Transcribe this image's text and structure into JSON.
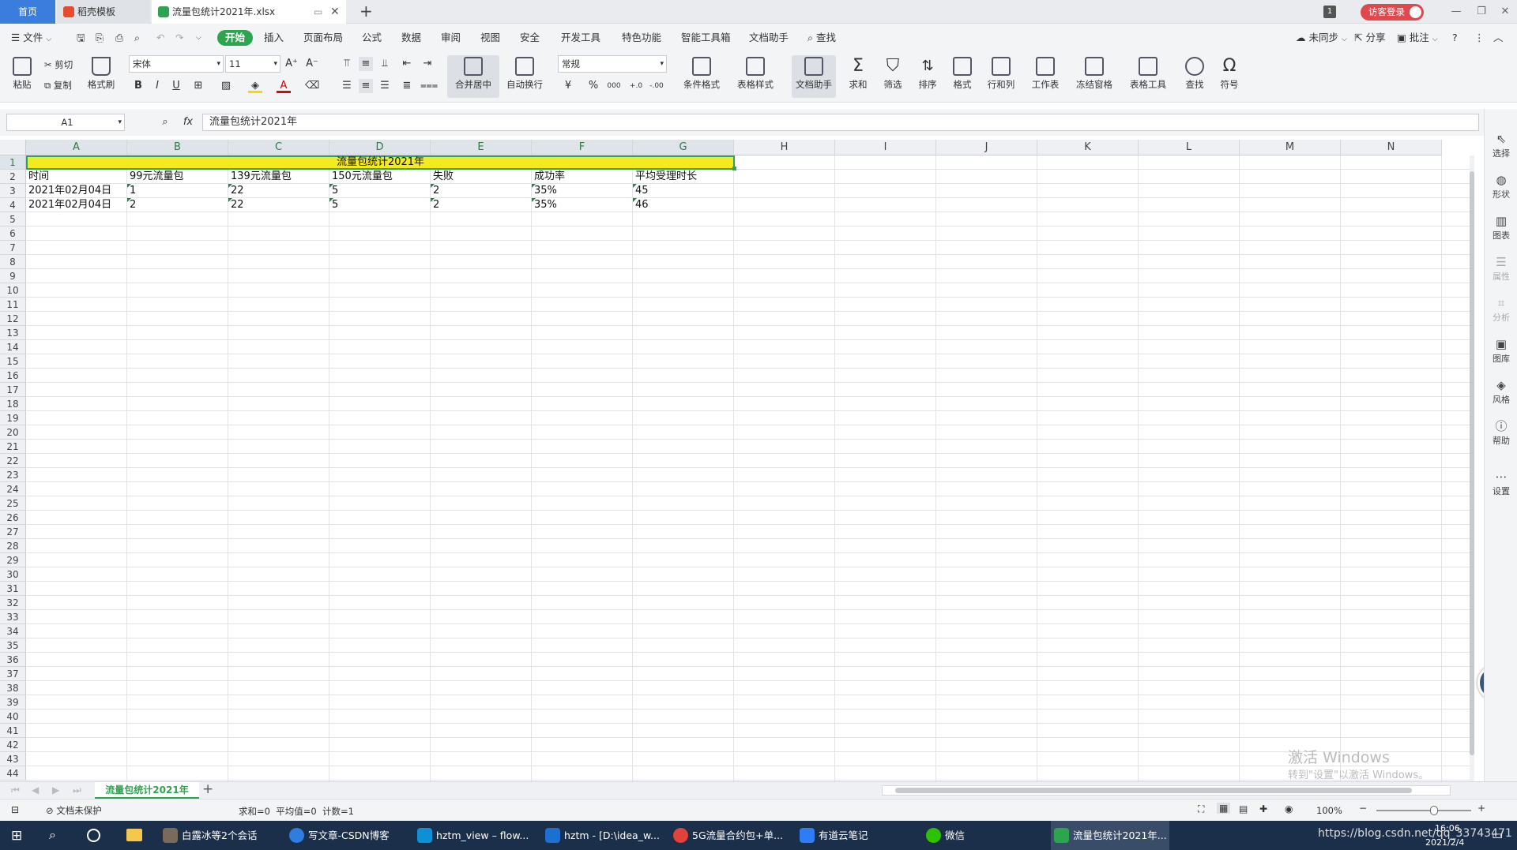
{
  "titlebar": {
    "tab_home": "首页",
    "tab_template": "稻壳模板",
    "tab_file": "流量包统计2021年.xlsx",
    "badge": "1",
    "login": "访客登录"
  },
  "menubar": {
    "file": "文件",
    "start": "开始",
    "items": [
      "插入",
      "页面布局",
      "公式",
      "数据",
      "审阅",
      "视图",
      "安全",
      "开发工具",
      "特色功能",
      "智能工具箱",
      "文档助手"
    ],
    "search": "查找",
    "sync": "未同步",
    "share": "分享",
    "annotate": "批注"
  },
  "ribbon": {
    "paste": "粘贴",
    "cut": "剪切",
    "copy": "复制",
    "format_painter": "格式刷",
    "font_name": "宋体",
    "font_size": "11",
    "merge": "合并居中",
    "wrap": "自动换行",
    "number_format": "常规",
    "cond_format": "条件格式",
    "table_style": "表格样式",
    "doc_assistant": "文档助手",
    "sum": "求和",
    "filter": "筛选",
    "sort": "排序",
    "format": "格式",
    "rowcol": "行和列",
    "worksheet": "工作表",
    "freeze": "冻结窗格",
    "table_tools": "表格工具",
    "find": "查找",
    "symbol": "符号"
  },
  "formula": {
    "name_box": "A1",
    "fx": "fx",
    "content": "流量包统计2021年"
  },
  "columns": [
    "A",
    "B",
    "C",
    "D",
    "E",
    "F",
    "G",
    "H",
    "I",
    "J",
    "K",
    "L",
    "M",
    "N"
  ],
  "rows": [
    "1",
    "2",
    "3",
    "4",
    "5",
    "6",
    "7",
    "8",
    "9",
    "10",
    "11",
    "12",
    "13",
    "14",
    "15",
    "16",
    "17",
    "18",
    "19",
    "20",
    "21",
    "22",
    "23",
    "24",
    "25",
    "26",
    "27",
    "28",
    "29",
    "30",
    "31",
    "32",
    "33",
    "34",
    "35",
    "36",
    "37",
    "38",
    "39",
    "40",
    "41",
    "42",
    "43",
    "44"
  ],
  "sheet": {
    "title": "流量包统计2021年",
    "headers": [
      "时间",
      "99元流量包",
      "139元流量包",
      "150元流量包",
      "失败",
      "成功率",
      "平均受理时长"
    ],
    "data": [
      [
        "2021年02月04日",
        "1",
        "22",
        "5",
        "2",
        "35%",
        "45"
      ],
      [
        "2021年02月04日",
        "2",
        "22",
        "5",
        "2",
        "35%",
        "46"
      ]
    ]
  },
  "sidepanel": [
    "选择",
    "形状",
    "图表",
    "属性",
    "分析",
    "图库",
    "风格",
    "帮助",
    "设置"
  ],
  "sheettab": "流量包统计2021年",
  "status": {
    "protect": "文档未保护",
    "stats": "求和=0  平均值=0  计数=1",
    "zoom": "100%"
  },
  "watermark": {
    "line1": "激活 Windows",
    "line2": "转到\"设置\"以激活 Windows。"
  },
  "taskbar": {
    "items": [
      "白露冰等2个会话",
      "写文章-CSDN博客",
      "hztm_view – flow...",
      "hztm - [D:\\idea_w...",
      "5G流量合约包+单...",
      "有道云笔记",
      "微信",
      "流量包统计2021年..."
    ],
    "time": "16:06",
    "date": "2021/2/4",
    "url": "https://blog.csdn.net/qq_33743471"
  }
}
